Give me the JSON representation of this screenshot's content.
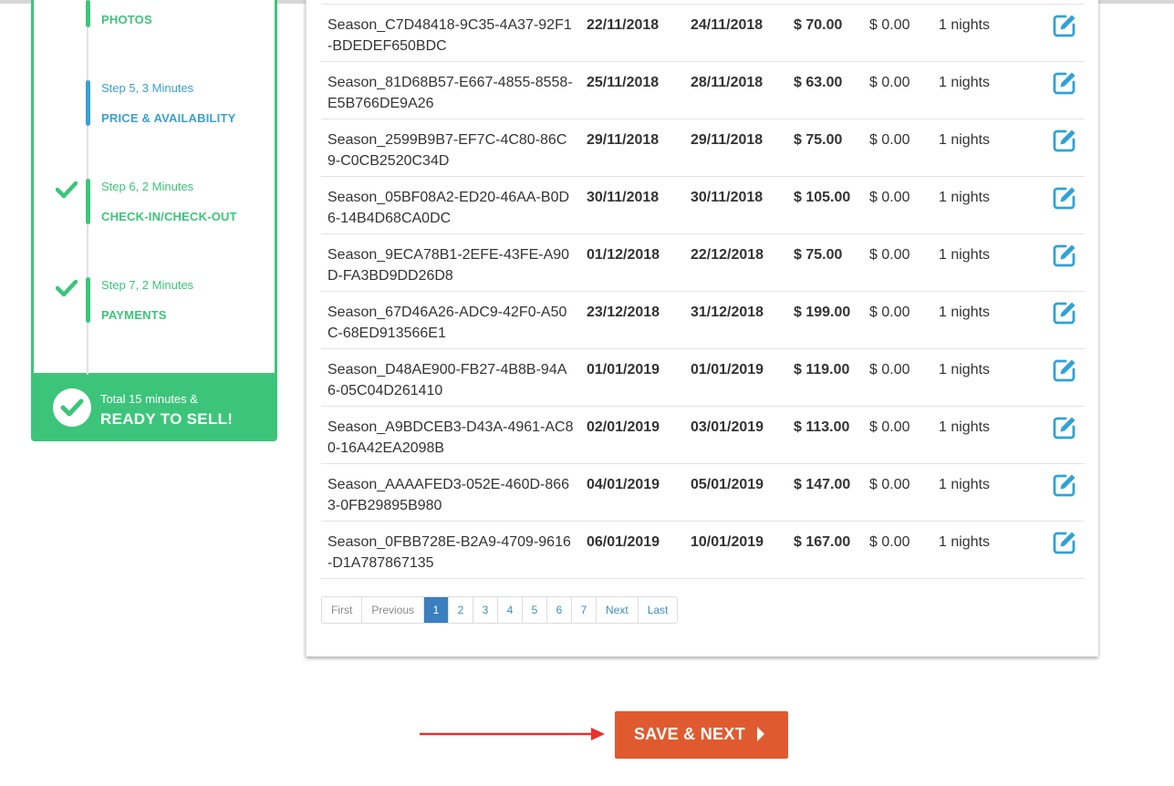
{
  "sidebar": {
    "steps": [
      {
        "title": "",
        "name": "PHOTOS",
        "completed": false
      },
      {
        "title": "Step 5, 3 Minutes",
        "name": "PRICE & AVAILABILITY",
        "completed": false
      },
      {
        "title": "Step 6, 2 Minutes",
        "name": "CHECK-IN/CHECK-OUT",
        "completed": true
      },
      {
        "title": "Step 7, 2 Minutes",
        "name": "PAYMENTS",
        "completed": true
      }
    ],
    "summary": {
      "total": "Total 15 minutes &",
      "ready": "READY TO SELL!"
    }
  },
  "seasons": [
    {
      "name": "Season_C7D48418-9C35-4A37-92F1-BDEDEF650BDC",
      "from": "22/11/2018",
      "to": "24/11/2018",
      "price": "$ 70.00",
      "extra": "$ 0.00",
      "min": "1 nights"
    },
    {
      "name": "Season_81D68B57-E667-4855-8558-E5B766DE9A26",
      "from": "25/11/2018",
      "to": "28/11/2018",
      "price": "$ 63.00",
      "extra": "$ 0.00",
      "min": "1 nights"
    },
    {
      "name": "Season_2599B9B7-EF7C-4C80-86C9-C0CB2520C34D",
      "from": "29/11/2018",
      "to": "29/11/2018",
      "price": "$ 75.00",
      "extra": "$ 0.00",
      "min": "1 nights"
    },
    {
      "name": "Season_05BF08A2-ED20-46AA-B0D6-14B4D68CA0DC",
      "from": "30/11/2018",
      "to": "30/11/2018",
      "price": "$ 105.00",
      "extra": "$ 0.00",
      "min": "1 nights"
    },
    {
      "name": "Season_9ECA78B1-2EFE-43FE-A90D-FA3BD9DD26D8",
      "from": "01/12/2018",
      "to": "22/12/2018",
      "price": "$ 75.00",
      "extra": "$ 0.00",
      "min": "1 nights"
    },
    {
      "name": "Season_67D46A26-ADC9-42F0-A50C-68ED913566E1",
      "from": "23/12/2018",
      "to": "31/12/2018",
      "price": "$ 199.00",
      "extra": "$ 0.00",
      "min": "1 nights"
    },
    {
      "name": "Season_D48AE900-FB27-4B8B-94A6-05C04D261410",
      "from": "01/01/2019",
      "to": "01/01/2019",
      "price": "$ 119.00",
      "extra": "$ 0.00",
      "min": "1 nights"
    },
    {
      "name": "Season_A9BDCEB3-D43A-4961-AC80-16A42EA2098B",
      "from": "02/01/2019",
      "to": "03/01/2019",
      "price": "$ 113.00",
      "extra": "$ 0.00",
      "min": "1 nights"
    },
    {
      "name": "Season_AAAAFED3-052E-460D-8663-0FB29895B980",
      "from": "04/01/2019",
      "to": "05/01/2019",
      "price": "$ 147.00",
      "extra": "$ 0.00",
      "min": "1 nights"
    },
    {
      "name": "Season_0FBB728E-B2A9-4709-9616-D1A787867135",
      "from": "06/01/2019",
      "to": "10/01/2019",
      "price": "$ 167.00",
      "extra": "$ 0.00",
      "min": "1 nights"
    }
  ],
  "pagination": {
    "first": "First",
    "previous": "Previous",
    "pages": [
      "1",
      "2",
      "3",
      "4",
      "5",
      "6",
      "7"
    ],
    "current": "1",
    "next": "Next",
    "last": "Last"
  },
  "footer": {
    "save_label": "SAVE & NEXT"
  },
  "colors": {
    "green": "#3cc57a",
    "blue": "#3aa0d4",
    "button": "#e05a30",
    "arrow": "#e8322b",
    "page_active": "#3a7fc0"
  },
  "icons": {
    "edit": "edit-icon",
    "check": "check-icon",
    "caret": "caret-right-icon"
  }
}
